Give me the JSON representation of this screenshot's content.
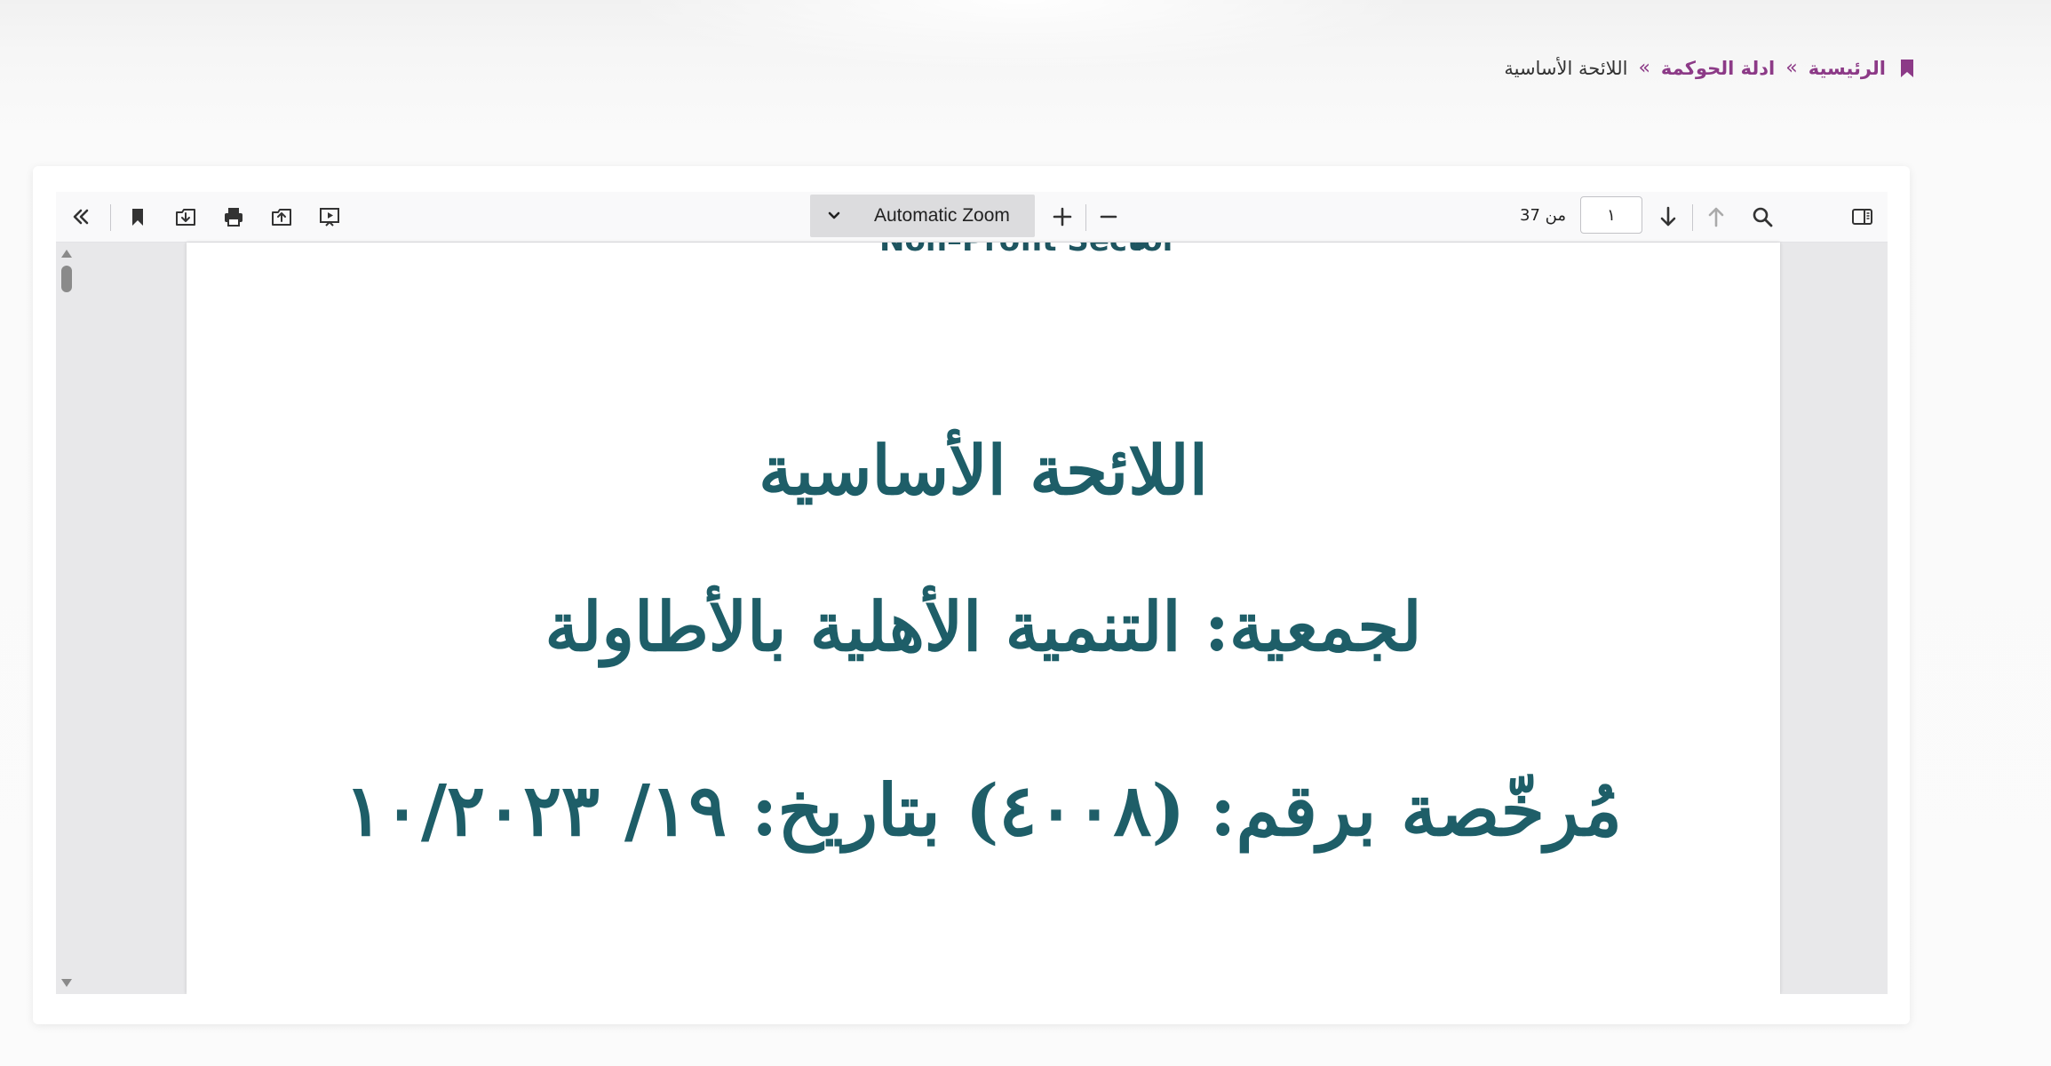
{
  "breadcrumb": {
    "home": "الرئيسية",
    "section": "ادلة الحوكمة",
    "current": "اللائحة الأساسية",
    "separator": "»"
  },
  "toolbar": {
    "zoom_label": "Automatic Zoom",
    "page_current": "١",
    "page_of_text": "من 37"
  },
  "document": {
    "cut_header": "Non–Profit Sector",
    "line1": "اللائحة الأساسية",
    "line2": "لجمعية: التنمية الأهلية بالأطاولة",
    "line3": "مُرخّصة برقم: (٤٠٠٨) بتاريخ: ١٩/ ١٠/٢٠٢٣"
  },
  "colors": {
    "accent": "#8c3a87",
    "doc_text": "#1e5e68"
  }
}
